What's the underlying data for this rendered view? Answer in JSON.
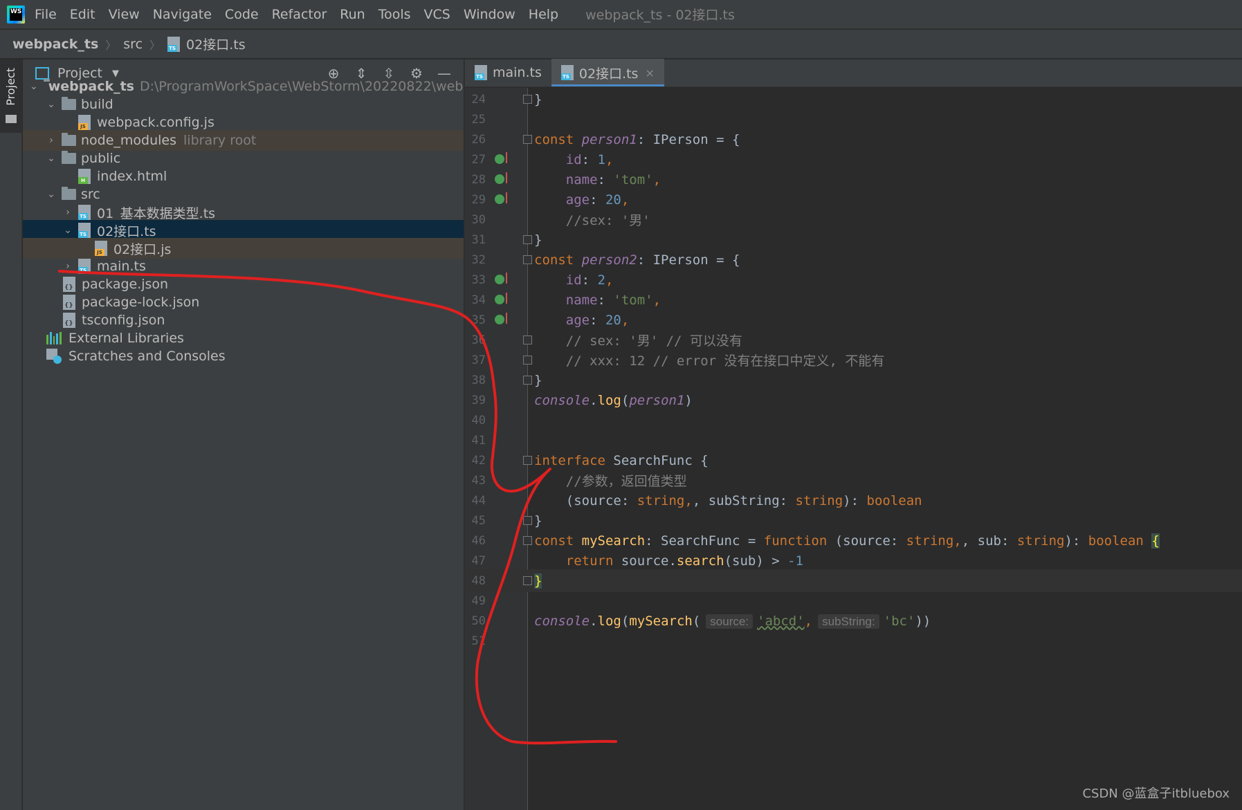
{
  "menu": {
    "items": [
      {
        "label": "File"
      },
      {
        "label": "Edit"
      },
      {
        "label": "View"
      },
      {
        "label": "Navigate"
      },
      {
        "label": "Code"
      },
      {
        "label": "Refactor"
      },
      {
        "label": "Run"
      },
      {
        "label": "Tools"
      },
      {
        "label": "VCS"
      },
      {
        "label": "Window"
      },
      {
        "label": "Help"
      }
    ],
    "window_title": "webpack_ts - 02接口.ts",
    "logo_text": "WS"
  },
  "breadcrumb": {
    "project": "webpack_ts",
    "folder": "src",
    "file": "02接口.ts"
  },
  "stripe": {
    "project_tab": "Project"
  },
  "project_panel": {
    "title": "Project",
    "tree": {
      "root_name": "webpack_ts",
      "root_path": "D:\\ProgramWorkSpace\\WebStorm\\20220822\\webpack_ts",
      "build": "build",
      "webpack_config": "webpack.config.js",
      "node_modules": "node_modules",
      "library_root": "library root",
      "public": "public",
      "index_html": "index.html",
      "src": "src",
      "file01": "01_基本数据类型.ts",
      "file02": "02接口.ts",
      "file02js": "02接口.js",
      "main": "main.ts",
      "package_json": "package.json",
      "package_lock": "package-lock.json",
      "tsconfig": "tsconfig.json",
      "ext_libs": "External Libraries",
      "scratches": "Scratches and Consoles"
    }
  },
  "editor": {
    "tabs": [
      {
        "label": "main.ts",
        "active": false
      },
      {
        "label": "02接口.ts",
        "active": true
      }
    ],
    "close_glyph": "×",
    "line_numbers": [
      "24",
      "25",
      "26",
      "27",
      "28",
      "29",
      "30",
      "31",
      "32",
      "33",
      "34",
      "35",
      "36",
      "37",
      "38",
      "39",
      "40",
      "41",
      "42",
      "43",
      "44",
      "45",
      "46",
      "47",
      "48",
      "49",
      "50",
      "51"
    ],
    "code": {
      "l24": "}",
      "l26_kw": "const ",
      "l26_var": "person1",
      "l26_rest": ": IPerson = {",
      "l27_key": "id",
      "l27_num": "1",
      "l28_key": "name",
      "l28_str": "'tom'",
      "l29_key": "age",
      "l29_num": "20",
      "l30": "//sex: '男'",
      "l31": "}",
      "l32_kw": "const ",
      "l32_var": "person2",
      "l32_rest": ": IPerson = {",
      "l33_key": "id",
      "l33_num": "2",
      "l34_key": "name",
      "l34_str": "'tom'",
      "l35_key": "age",
      "l35_num": "20",
      "l36": "// sex: '男' // 可以没有",
      "l37": "// xxx: 12 // error 没有在接口中定义, 不能有",
      "l38": "}",
      "l39_obj": "console",
      "l39_method": "log",
      "l39_arg": "person1",
      "l42_kw": "interface ",
      "l42_name": "SearchFunc {",
      "l43": "//参数，返回值类型",
      "l44_a": "(source: ",
      "l44_t1": "string",
      "l44_b": ", subString: ",
      "l44_t2": "string",
      "l44_c": "): ",
      "l44_t3": "boolean",
      "l45": "}",
      "l46_kw": "const ",
      "l46_fn": "mySearch",
      "l46_a": ": SearchFunc = ",
      "l46_kw2": "function",
      "l46_b": " (source: ",
      "l46_t1": "string",
      "l46_c": ", sub: ",
      "l46_t2": "string",
      "l46_d": "): ",
      "l46_t3": "boolean",
      "l46_brace": "{",
      "l47_kw": "return ",
      "l47_a": "source.",
      "l47_m": "search",
      "l47_b": "(sub) > ",
      "l47_num": "-1",
      "l48": "}",
      "l50_obj": "console",
      "l50_method": "log",
      "l50_fn": "mySearch",
      "l50_hint1": "source:",
      "l50_str1": "'abcd'",
      "l50_hint2": "subString:",
      "l50_str2": "'bc'"
    }
  },
  "watermark": "CSDN @蓝盒子itbluebox",
  "colors": {
    "annotation_stroke": "#e02020",
    "accent": "#4a88c7"
  }
}
